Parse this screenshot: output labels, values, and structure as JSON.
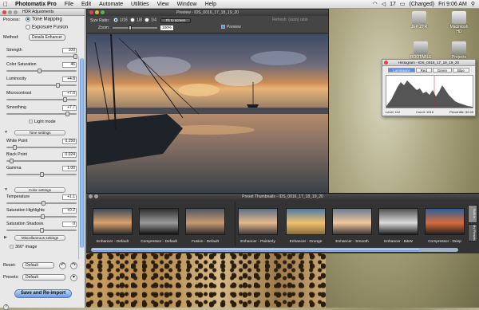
{
  "menubar": {
    "apple": "",
    "items": [
      "Photomatix Pro",
      "File",
      "Edit",
      "Automate",
      "Utilities",
      "View",
      "Window",
      "Help"
    ],
    "status": {
      "sound": "17",
      "battery": "(Charged)",
      "time": "Fri 9:06 AM"
    }
  },
  "adjust": {
    "title": "HDR Adjustments",
    "process_label": "Process:",
    "process_options": [
      "Tone Mapping",
      "Exposure Fusion"
    ],
    "method_label": "Method:",
    "method_value": "Details Enhancer",
    "sliders": [
      {
        "label": "Strength",
        "value": "100",
        "pos": 1.0
      },
      {
        "label": "Color Saturation",
        "value": "46",
        "pos": 0.46
      },
      {
        "label": "Luminosity",
        "value": "+4.8",
        "pos": 0.74
      },
      {
        "label": "Microcontrast",
        "value": "+7.0",
        "pos": 0.85
      },
      {
        "label": "Smoothing",
        "value": "+7.7",
        "pos": 0.88
      }
    ],
    "light_mode_label": "Light mode",
    "tone_section": "Tone settings",
    "tone": [
      {
        "label": "White Point",
        "value": "0.250",
        "pos": 0.1
      },
      {
        "label": "Black Point",
        "value": "0.024",
        "pos": 0.05
      },
      {
        "label": "Gamma",
        "value": "1.00",
        "pos": 0.5
      }
    ],
    "color_section": "Color settings",
    "color": [
      {
        "label": "Temperature",
        "value": "+1.1",
        "pos": 0.52
      },
      {
        "label": "Saturation Highlights",
        "value": "+0.2",
        "pos": 0.51
      },
      {
        "label": "Saturation Shadows",
        "value": "0",
        "pos": 0.5
      }
    ],
    "misc_section": "Miscellaneous settings",
    "image360_label": "360° image",
    "reset_label": "Reset:",
    "reset_value": "Default",
    "presets_label": "Presets:",
    "presets_value": "Default",
    "save_button": "Save and Re-import"
  },
  "preview": {
    "title": "Preview - IDS_0016_17_18_19_20",
    "size_ratio_label": "Size Ratio:",
    "ratios": [
      "1/16",
      "1/8",
      "1/4"
    ],
    "fit_button": "Fit to screen",
    "zoom_label": "Zoom:",
    "zoom_value": "100%",
    "preview_checkbox": "Preview",
    "refresh_label": "Refresh: (auto) ratio"
  },
  "histogram": {
    "title": "Histogram - IDS_0016_17_18_19_20",
    "tabs": [
      "Luminance",
      "Red",
      "Green",
      "Blue"
    ],
    "footer": {
      "level": "Level: 112",
      "count": "Count: 1916",
      "percentile": "Percentile: 59.49"
    }
  },
  "desktop_icons": [
    "JEP ZTR",
    "Macintosh HD",
    "BOOTABLE HD",
    "Projects"
  ],
  "thumbnails": {
    "title": "Preset Thumbnails - IDS_0016_17_18_19_20",
    "items": [
      "Enhancer - Default",
      "Compressor - Default",
      "Fusion - Default",
      "Enhancer - Painterly",
      "Enhancer - Grunge",
      "Enhancer - Smooth",
      "Enhancer - B&W",
      "Compressor - Deep"
    ],
    "side_tabs": [
      "Built-in",
      "My Presets"
    ]
  },
  "colors": {
    "accent": "#5e90e0",
    "panel": "#e8e8e8",
    "dark": "#3c3c3c"
  }
}
